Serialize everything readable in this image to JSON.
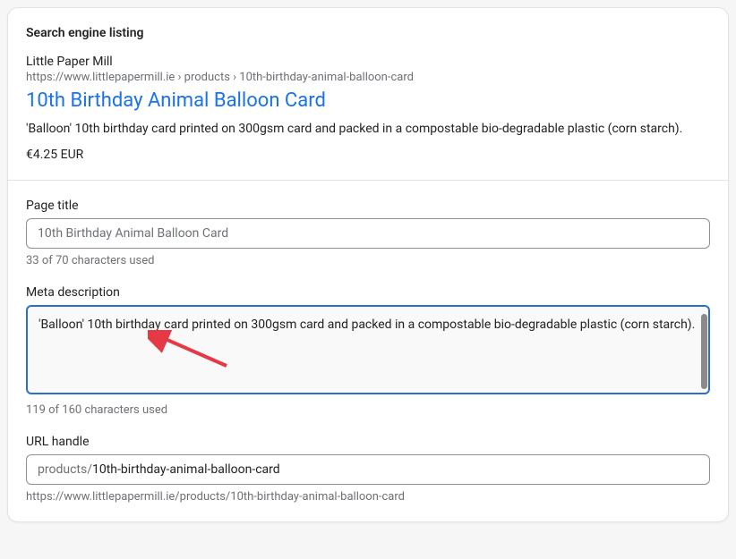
{
  "header": {
    "title": "Search engine listing"
  },
  "preview": {
    "site_name": "Little Paper Mill",
    "breadcrumb": "https://www.littlepapermill.ie › products › 10th-birthday-animal-balloon-card",
    "title": "10th Birthday Animal Balloon Card",
    "description": "'Balloon' 10th birthday card printed on 300gsm card and packed in a compostable bio-degradable plastic (corn starch).",
    "price": "€4.25 EUR"
  },
  "page_title": {
    "label": "Page title",
    "value": "10th Birthday Animal Balloon Card",
    "helper": "33 of 70 characters used"
  },
  "meta_description": {
    "label": "Meta description",
    "value": "'Balloon' 10th birthday card printed on 300gsm card and packed in a compostable bio-degradable plastic (corn starch).\n",
    "helper": "119 of 160 characters used"
  },
  "url_handle": {
    "label": "URL handle",
    "prefix": "products/",
    "value": "10th-birthday-animal-balloon-card",
    "helper": "https://www.littlepapermill.ie/products/10th-birthday-animal-balloon-card"
  }
}
